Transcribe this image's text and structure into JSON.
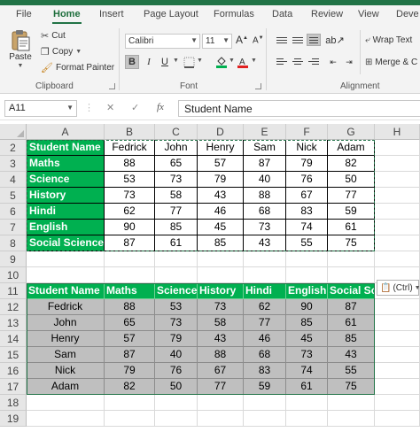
{
  "tabs": [
    "File",
    "Home",
    "Insert",
    "Page Layout",
    "Formulas",
    "Data",
    "Review",
    "View",
    "Deve"
  ],
  "active_tab": "Home",
  "clipboard": {
    "paste": "Paste",
    "cut": "Cut",
    "copy": "Copy",
    "format_painter": "Format Painter",
    "label": "Clipboard"
  },
  "font": {
    "name": "Calibri",
    "size": "11",
    "label": "Font",
    "bold": "B",
    "italic": "I",
    "underline": "U"
  },
  "alignment": {
    "wrap_text": "Wrap Text",
    "merge": "Merge & C",
    "label": "Alignment"
  },
  "formula_bar": {
    "name_box": "A11",
    "cancel": "✕",
    "enter": "✓",
    "fx": "fx",
    "content": "Student Name"
  },
  "columns": [
    "A",
    "B",
    "C",
    "D",
    "E",
    "F",
    "G",
    "H"
  ],
  "rows": [
    "2",
    "3",
    "4",
    "5",
    "6",
    "7",
    "8",
    "9",
    "10",
    "11",
    "12",
    "13",
    "14",
    "15",
    "16",
    "17",
    "18",
    "19"
  ],
  "table1": {
    "header": [
      "Student Name",
      "Fedrick",
      "John",
      "Henry",
      "Sam",
      "Nick",
      "Adam"
    ],
    "rows": [
      [
        "Maths",
        "88",
        "65",
        "57",
        "87",
        "79",
        "82"
      ],
      [
        "Science",
        "53",
        "73",
        "79",
        "40",
        "76",
        "50"
      ],
      [
        "History",
        "73",
        "58",
        "43",
        "88",
        "67",
        "77"
      ],
      [
        "Hindi",
        "62",
        "77",
        "46",
        "68",
        "83",
        "59"
      ],
      [
        "English",
        "90",
        "85",
        "45",
        "73",
        "74",
        "61"
      ],
      [
        "Social Science",
        "87",
        "61",
        "85",
        "43",
        "55",
        "75"
      ]
    ]
  },
  "table2": {
    "header": [
      "Student Name",
      "Maths",
      "Science",
      "History",
      "Hindi",
      "English",
      "Social Sci"
    ],
    "rows": [
      [
        "Fedrick",
        "88",
        "53",
        "73",
        "62",
        "90",
        "87"
      ],
      [
        "John",
        "65",
        "73",
        "58",
        "77",
        "85",
        "61"
      ],
      [
        "Henry",
        "57",
        "79",
        "43",
        "46",
        "45",
        "85"
      ],
      [
        "Sam",
        "87",
        "40",
        "88",
        "68",
        "73",
        "43"
      ],
      [
        "Nick",
        "79",
        "76",
        "67",
        "83",
        "74",
        "55"
      ],
      [
        "Adam",
        "82",
        "50",
        "77",
        "59",
        "61",
        "75"
      ]
    ]
  },
  "paste_options": "(Ctrl)",
  "colors": {
    "accent": "#217346",
    "green_fill": "#00b050",
    "gray_fill": "#bfbfbf"
  }
}
